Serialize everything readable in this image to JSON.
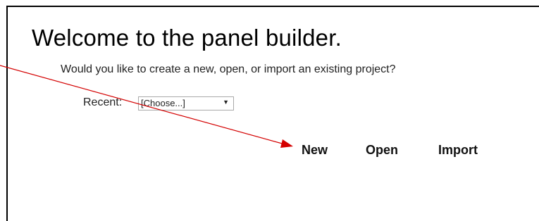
{
  "welcome": {
    "title": "Welcome to the panel builder.",
    "subtitle": "Would you like to create a new, open, or import an existing project?"
  },
  "recent": {
    "label": "Recent:",
    "selected": "[Choose...]",
    "arrow_glyph": "▼"
  },
  "actions": {
    "new_label": "New",
    "open_label": "Open",
    "import_label": "Import"
  },
  "annotation": {
    "arrow_color": "#d40000",
    "points_to": "New"
  }
}
